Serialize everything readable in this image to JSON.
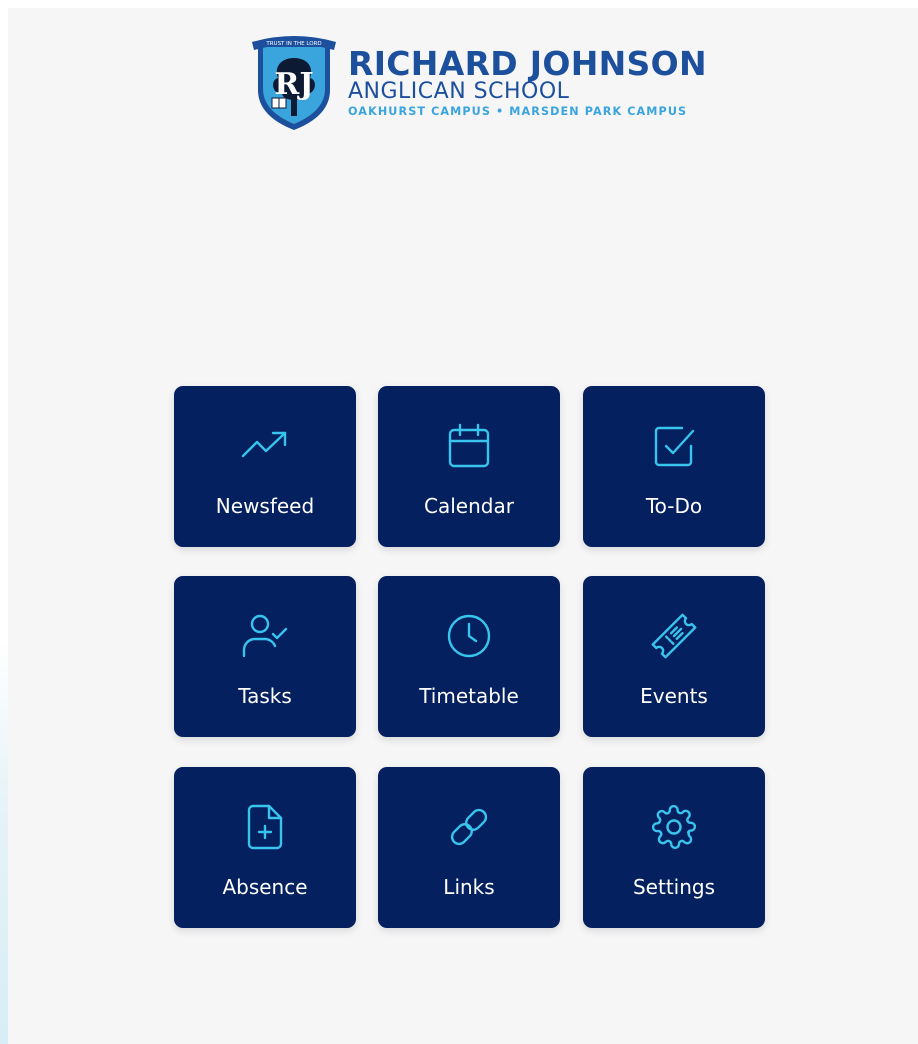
{
  "logo": {
    "name_line1": "RICHARD JOHNSON",
    "name_line2": "ANGLICAN SCHOOL",
    "campuses": "OAKHURST CAMPUS • MARSDEN PARK CAMPUS",
    "crest_motto": "TRUST IN THE LORD",
    "crest_monogram": "RJ",
    "colors": {
      "navy": "#1c4f9c",
      "light_blue": "#3aa4dc"
    }
  },
  "tiles": [
    {
      "label": "Newsfeed",
      "icon": "trending-up-icon"
    },
    {
      "label": "Calendar",
      "icon": "calendar-icon"
    },
    {
      "label": "To-Do",
      "icon": "checkbox-icon"
    },
    {
      "label": "Tasks",
      "icon": "user-check-icon"
    },
    {
      "label": "Timetable",
      "icon": "clock-icon"
    },
    {
      "label": "Events",
      "icon": "ticket-icon"
    },
    {
      "label": "Absence",
      "icon": "file-plus-icon"
    },
    {
      "label": "Links",
      "icon": "link-icon"
    },
    {
      "label": "Settings",
      "icon": "gear-icon"
    }
  ],
  "colors": {
    "tile_background": "#04205f",
    "icon_accent": "#38c4ec",
    "page_background": "#f6f6f7"
  }
}
